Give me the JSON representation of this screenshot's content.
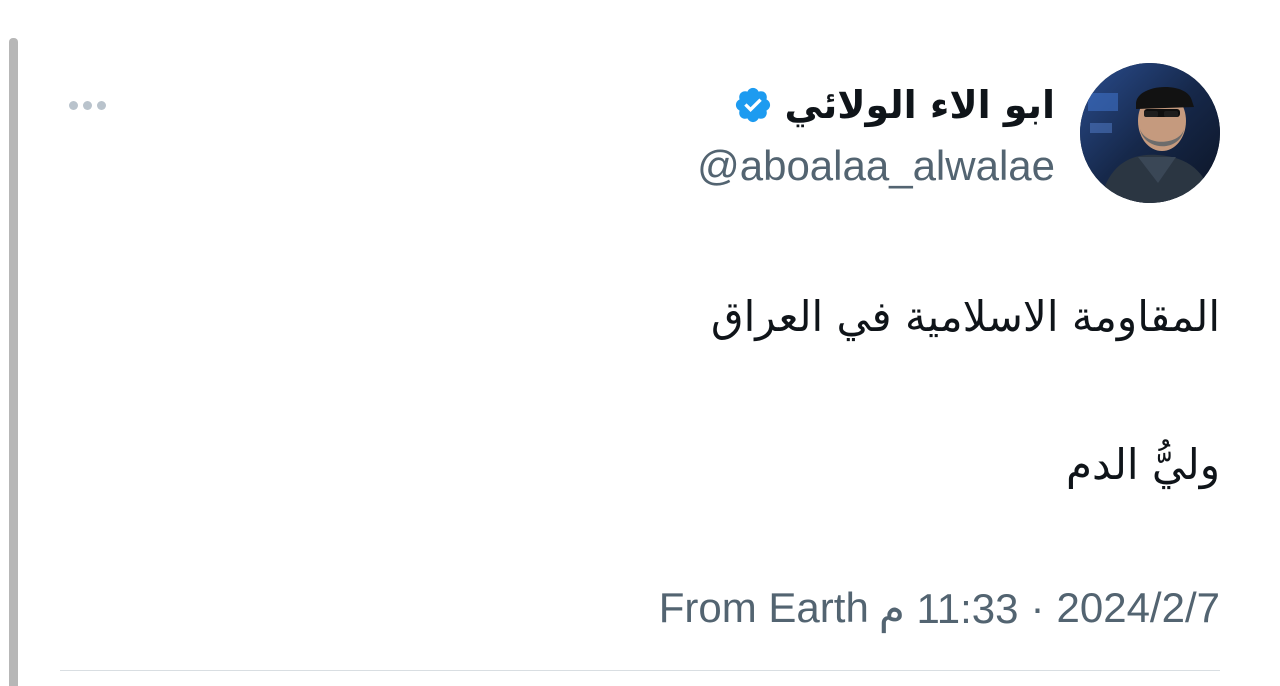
{
  "author": {
    "display_name": "ابو الاء الولائي",
    "handle": "@aboalaa_alwalae",
    "verified_icon": "verified-badge-icon",
    "verified_color": "#1d9bf0",
    "avatar": "avatar-photo"
  },
  "tweet": {
    "line1": "المقاومة الاسلامية في العراق",
    "line2": "وليُّ الدم"
  },
  "meta": {
    "source": "From Earth",
    "time": "11:33 م",
    "separator": "·",
    "date": "2024/2/7"
  },
  "more_icon": "more-horizontal-icon",
  "colors": {
    "text_primary": "#0f1419",
    "text_secondary": "#536471",
    "divider": "#d9dee2",
    "more_dots": "#b9c3cc"
  }
}
